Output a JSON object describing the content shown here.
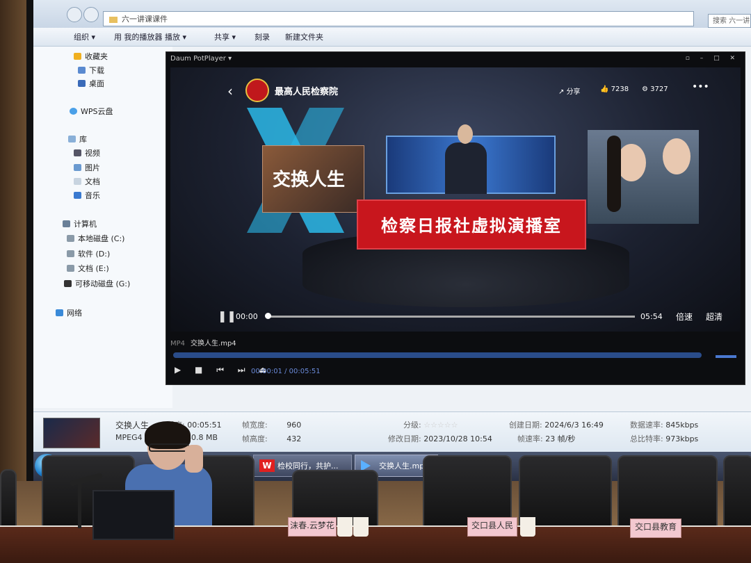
{
  "explorer": {
    "address": "六一讲课课件",
    "search_placeholder": "搜索 六一讲",
    "toolbar": {
      "organize": "组织 ▾",
      "play_with": "用 我的播放器 播放 ▾",
      "share": "共享 ▾",
      "burn": "刻录",
      "new_folder": "新建文件夹"
    },
    "nav": {
      "favorites": "收藏夹",
      "downloads": "下载",
      "desktop": "桌面",
      "wps_cloud": "WPS云盘",
      "libraries": "库",
      "videos": "视频",
      "pictures": "图片",
      "documents": "文档",
      "music": "音乐",
      "computer": "计算机",
      "drive_c": "本地磁盘 (C:)",
      "drive_d": "软件 (D:)",
      "drive_e": "文档 (E:)",
      "drive_g": "可移动磁盘 (G:)",
      "network": "网络"
    }
  },
  "player": {
    "app_title": "Daum PotPlayer ▾",
    "channel_name": "最高人民检察院",
    "share_label": "分享",
    "likes": "7238",
    "comments": "3727",
    "poster_title": "交换人生",
    "desk_sign": "检察日报社虚拟演播室",
    "time_current": "00:00",
    "time_total": "05:54",
    "speed_label": "倍速",
    "quality_label": "超清",
    "format": "MP4",
    "filename": "交换人生.mp4",
    "player_time": "00:00:01 / 00:05:51"
  },
  "details": {
    "name": "交换人生",
    "type": "MPEG4",
    "length_label": "长度:",
    "length": "00:05:51",
    "size": "40.8 MB",
    "frame_width_label": "帧宽度:",
    "frame_width": "960",
    "frame_height_label": "帧高度:",
    "frame_height": "432",
    "rating_label": "分级:",
    "modified_label": "修改日期:",
    "modified": "2023/10/28 10:54",
    "created_label": "创建日期:",
    "created": "2024/6/3 16:49",
    "frame_rate_label": "帧速率:",
    "frame_rate": "23 帧/秒",
    "data_rate_label": "数据速率:",
    "data_rate": "845kbps",
    "total_bitrate_label": "总比特率:",
    "total_bitrate": "973kbps"
  },
  "taskbar": {
    "wps_label": "检校同行，共护...",
    "wps_icon": "W",
    "player_label": "交换人生.mp4"
  },
  "room": {
    "nameplate_1": "沫春.云梦花",
    "nameplate_2": "交口县人民",
    "nameplate_3": "交口县教育"
  },
  "colors": {
    "desk_sign": "#c8161d",
    "taskbar": "#2a3145",
    "explorer_bg": "#eef2f6"
  }
}
